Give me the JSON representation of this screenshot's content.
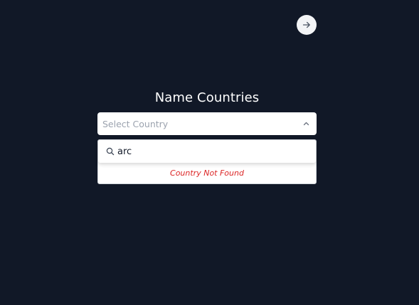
{
  "header": {
    "next_icon": "arrow-right-icon"
  },
  "main": {
    "title": "Name Countries",
    "select": {
      "placeholder": "Select Country",
      "chevron_icon": "chevron-up-icon"
    },
    "dropdown": {
      "search_icon": "search-icon",
      "search_value": "arc",
      "empty_message": "Country Not Found"
    }
  },
  "colors": {
    "background": "#111827",
    "error_text": "#dc2626",
    "placeholder_text": "#9ca3af"
  }
}
